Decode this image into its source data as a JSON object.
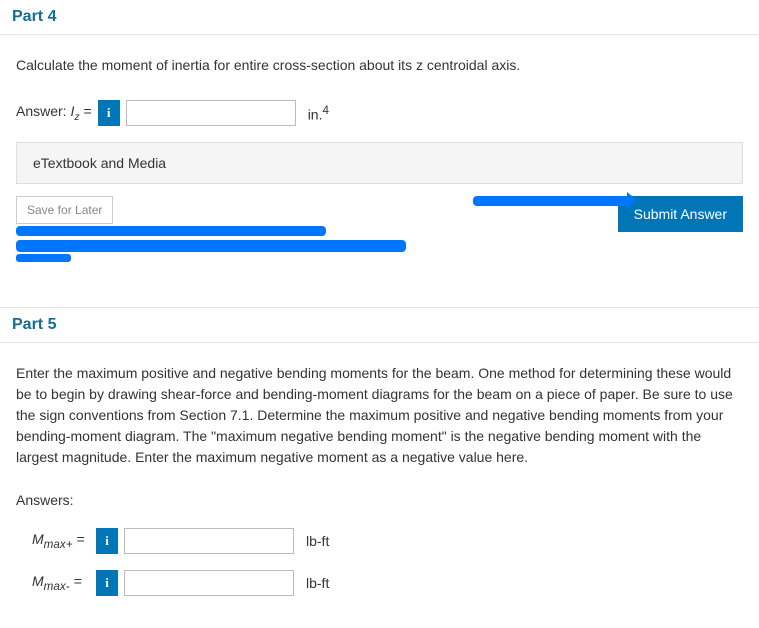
{
  "part4": {
    "title": "Part 4",
    "prompt": "Calculate the moment of inertia for entire cross-section about its z centroidal axis.",
    "answer_label_prefix": "Answer: ",
    "answer_var": "I",
    "answer_sub": "z",
    "answer_eq": " = ",
    "info": "i",
    "input_value": "",
    "unit_prefix": "in.",
    "unit_sup": "4",
    "etextbook": "eTextbook and Media",
    "save_label": "Save for Later",
    "submit_label": "Submit Answer"
  },
  "part5": {
    "title": "Part 5",
    "prompt": "Enter the maximum positive and negative bending moments for the beam. One method for determining these would be to begin by drawing shear-force and bending-moment diagrams for the beam on a piece of paper. Be sure to use the sign conventions from Section 7.1. Determine the maximum positive and negative bending moments from your bending-moment diagram. The \"maximum negative bending moment\" is the negative bending moment with the largest magnitude. Enter the maximum negative moment as a negative value here.",
    "answers_label": "Answers:",
    "mmax_pos": {
      "var": "M",
      "sub": "max+",
      "eq": " = ",
      "info": "i",
      "value": "",
      "unit": "lb-ft"
    },
    "mmax_neg": {
      "var": "M",
      "sub": "max-",
      "eq": " = ",
      "info": "i",
      "value": "",
      "unit": "lb-ft"
    }
  }
}
